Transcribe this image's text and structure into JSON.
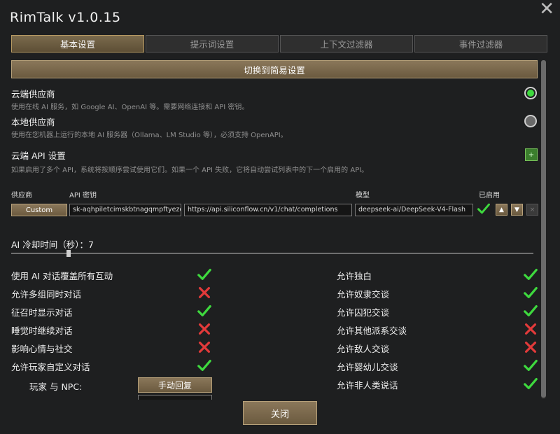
{
  "window": {
    "title": "RimTalk v1.0.15"
  },
  "tabs": [
    {
      "label": "基本设置",
      "active": true
    },
    {
      "label": "提示词设置",
      "active": false
    },
    {
      "label": "上下文过滤器",
      "active": false
    },
    {
      "label": "事件过滤器",
      "active": false
    }
  ],
  "simple_toggle_label": "切换到简易设置",
  "cloud": {
    "title": "云端供应商",
    "desc": "使用在线 AI 服务，如 Google AI、OpenAI 等。需要网络连接和 API 密钥。",
    "selected": true
  },
  "local": {
    "title": "本地供应商",
    "desc": "使用在您机器上运行的本地 AI 服务器（Ollama、LM Studio 等），必须支持 OpenAPI。",
    "selected": false
  },
  "api_settings": {
    "title": "云端 API 设置",
    "desc": "如果启用了多个 API，系统将按顺序尝试使用它们。如果一个 API 失败，它将自动尝试列表中的下一个启用的 API。",
    "add_label": "+",
    "columns": {
      "provider": "供应商",
      "key": "API 密钥",
      "model": "模型",
      "enabled": "已启用"
    },
    "row": {
      "provider": "Custom",
      "key": "sk-aqhpiletcimskbtnagqmpftyezqm",
      "url": "https://api.siliconflow.cn/v1/chat/completions",
      "model": "deepseek-ai/DeepSeek-V4-Flash",
      "up_label": "▲",
      "down_label": "▼",
      "remove_label": "×"
    }
  },
  "cooldown": {
    "label": "AI 冷却时间（秒）：7",
    "value": 7,
    "fraction": 0.11
  },
  "options_left": [
    {
      "label": "使用 AI 对话覆盖所有互动",
      "enabled": true
    },
    {
      "label": "允许多组同时对话",
      "enabled": false
    },
    {
      "label": "征召时显示对话",
      "enabled": true
    },
    {
      "label": "睡觉时继续对话",
      "enabled": false
    },
    {
      "label": "影响心情与社交",
      "enabled": false
    },
    {
      "label": "允许玩家自定义对话",
      "enabled": true
    }
  ],
  "options_right": [
    {
      "label": "允许独白",
      "enabled": true
    },
    {
      "label": "允许奴隶交谈",
      "enabled": true
    },
    {
      "label": "允许囚犯交谈",
      "enabled": true
    },
    {
      "label": "允许其他派系交谈",
      "enabled": false
    },
    {
      "label": "允许敌人交谈",
      "enabled": false
    },
    {
      "label": "允许婴幼儿交谈",
      "enabled": true
    },
    {
      "label": "允许非人类说话",
      "enabled": true
    }
  ],
  "player_npc": {
    "label": "玩家 与 NPC:",
    "button": "手动回复"
  },
  "close_label": "关闭",
  "colors": {
    "accent": "#7a6a4d",
    "check": "#3ed93e",
    "cross": "#e23a3a"
  }
}
